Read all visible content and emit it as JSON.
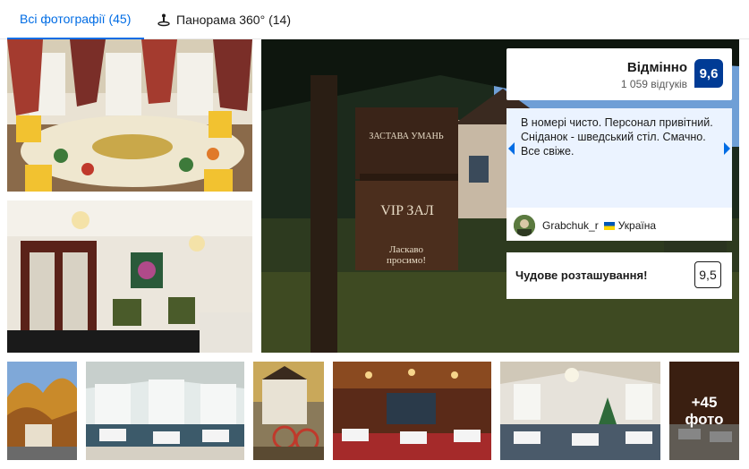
{
  "tabs": {
    "all_photos": "Всі фотографії (45)",
    "panorama": "Панорама 360° (14)"
  },
  "rating": {
    "word": "Відмінно",
    "count": "1 059 відгуків",
    "score": "9,6"
  },
  "review": {
    "text": "В номері чисто. Персонал привітний. Сніданок - шведський стіл. Смачно. Все свіже.",
    "reviewer_name": "Grabchuk_r",
    "reviewer_country": "Україна"
  },
  "location": {
    "text": "Чудове розташування!",
    "score": "9,5"
  },
  "sign": {
    "line1": "ЗАСТАВА УМАНЬ",
    "line2": "VIP ЗАЛ",
    "line3": "Ласкаво",
    "line4": "просимо!"
  },
  "more_photos": {
    "count": "+45",
    "label": "фото"
  },
  "colors": {
    "brand_blue": "#006ce4",
    "score_bg": "#003b95"
  },
  "icons": {
    "panorama": "panorama-360-icon",
    "prev": "chevron-left-icon",
    "next": "chevron-right-icon"
  }
}
